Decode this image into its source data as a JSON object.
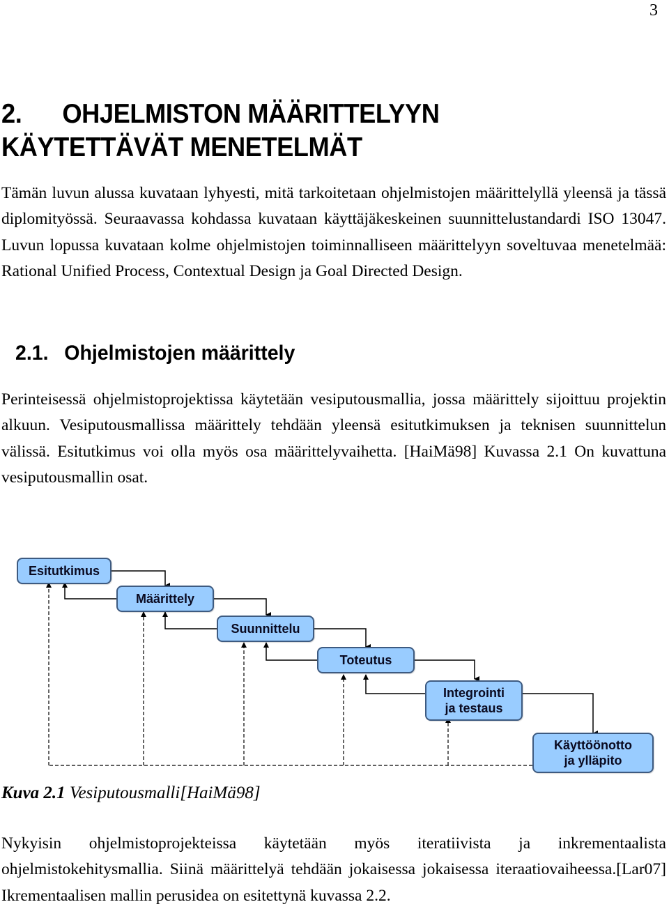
{
  "page_number": "3",
  "chapter": {
    "number": "2.",
    "title_line1": "OHJELMISTON MÄÄRITTELYYN",
    "title_line2": "KÄYTETTÄVÄT MENETELMÄT"
  },
  "intro_paragraph": "Tämän luvun alussa kuvataan lyhyesti, mitä tarkoitetaan ohjelmistojen määrittelyllä yleensä ja tässä diplomityössä. Seuraavassa kohdassa kuvataan käyttäjäkeskeinen suunnittelustandardi ISO 13047. Luvun lopussa kuvataan kolme ohjelmistojen toiminnalliseen määrittelyyn soveltuvaa menetelmää: Rational Unified Process, Contextual Design ja Goal Directed Design.",
  "section": {
    "number": "2.1.",
    "title": "Ohjelmistojen määrittely"
  },
  "section_paragraph": "Perinteisessä ohjelmistoprojektissa käytetään vesiputousmallia, jossa määrittely sijoittuu projektin alkuun. Vesiputousmallissa määrittely tehdään yleensä esitutkimuksen ja teknisen suunnittelun välissä. Esitutkimus voi olla myös osa määrittelyvaihetta. [HaiMä98] Kuvassa 2.1 On kuvattuna vesiputousmallin osat.",
  "diagram": {
    "box_color": "#99ccff",
    "border_color": "#3d5a80",
    "phases": [
      {
        "id": "esitutkimus",
        "lines": [
          "Esitutkimus"
        ]
      },
      {
        "id": "maarittely",
        "lines": [
          "Määrittely"
        ]
      },
      {
        "id": "suunnittelu",
        "lines": [
          "Suunnittelu"
        ]
      },
      {
        "id": "toteutus",
        "lines": [
          "Toteutus"
        ]
      },
      {
        "id": "integrointi",
        "lines": [
          "Integrointi",
          "ja testaus"
        ]
      },
      {
        "id": "kayttoonotto",
        "lines": [
          "Käyttöönotto",
          "ja ylläpito"
        ]
      }
    ]
  },
  "caption": {
    "label": "Kuva 2.1",
    "text": " Vesiputousmalli[HaiMä98]"
  },
  "closing_paragraph": "Nykyisin ohjelmistoprojekteissa käytetään myös iteratiivista ja inkrementaalista ohjelmistokehitysmallia. Siinä määrittelyä tehdään jokaisessa jokaisessa iteraatiovaiheessa.[Lar07] Ikrementaalisen mallin perusidea on esitettynä kuvassa 2.2."
}
